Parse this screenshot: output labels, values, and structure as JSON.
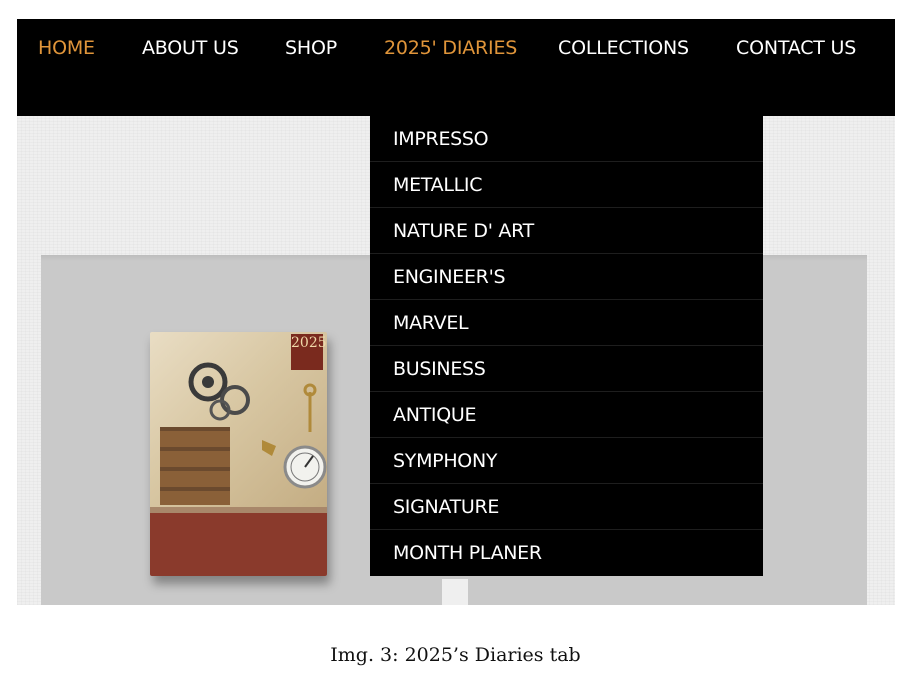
{
  "nav": {
    "items": [
      {
        "label": "HOME",
        "active": true
      },
      {
        "label": "ABOUT US",
        "active": false
      },
      {
        "label": "SHOP",
        "active": false
      },
      {
        "label": "2025' DIARIES",
        "active": true
      },
      {
        "label": "COLLECTIONS",
        "active": false
      },
      {
        "label": "CONTACT US",
        "active": false
      }
    ]
  },
  "dropdown": {
    "items": [
      {
        "label": "IMPRESSO"
      },
      {
        "label": "METALLIC"
      },
      {
        "label": "NATURE D' ART"
      },
      {
        "label": "ENGINEER'S"
      },
      {
        "label": "MARVEL"
      },
      {
        "label": "BUSINESS"
      },
      {
        "label": "ANTIQUE"
      },
      {
        "label": "SYMPHONY"
      },
      {
        "label": "SIGNATURE"
      },
      {
        "label": "MONTH PLANER"
      }
    ]
  },
  "product": {
    "year_badge": "2025"
  },
  "caption": "Img. 3: 2025’s Diaries tab",
  "colors": {
    "nav_bg": "#000000",
    "nav_text": "#ffffff",
    "nav_active": "#e0953a",
    "page_bg": "#efefef",
    "panel_bg": "#c9c9c9"
  }
}
